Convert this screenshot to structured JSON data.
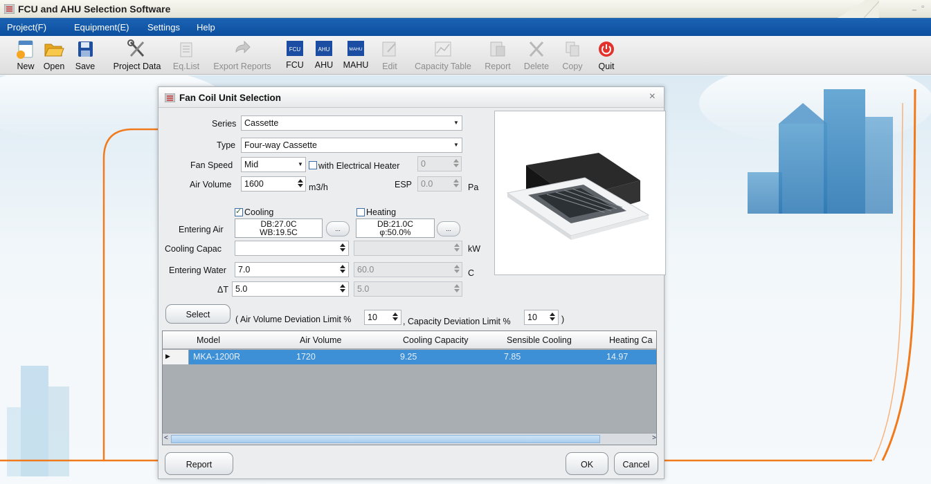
{
  "window": {
    "title": "FCU and AHU Selection Software",
    "controls": "_ ▫"
  },
  "menu": [
    "Project(F)",
    "Equipment(E)",
    "Settings",
    "Help"
  ],
  "toolbar": [
    {
      "label": "New",
      "icon": "new-project-icon",
      "enabled": true
    },
    {
      "label": "Open",
      "icon": "open-folder-icon",
      "enabled": true
    },
    {
      "label": "Save",
      "icon": "save-disk-icon",
      "enabled": true
    },
    {
      "label": "Project Data",
      "icon": "tools-icon",
      "enabled": true
    },
    {
      "label": "Eq.List",
      "icon": "list-icon",
      "enabled": false
    },
    {
      "label": "Export Reports",
      "icon": "export-arrow-icon",
      "enabled": false
    },
    {
      "label": "FCU",
      "icon": "fcu-icon",
      "enabled": true
    },
    {
      "label": "AHU",
      "icon": "ahu-icon",
      "enabled": true
    },
    {
      "label": "MAHU",
      "icon": "mahu-icon",
      "enabled": true
    },
    {
      "label": "Edit",
      "icon": "edit-icon",
      "enabled": false
    },
    {
      "label": "Capacity Table",
      "icon": "chart-icon",
      "enabled": false
    },
    {
      "label": "Report",
      "icon": "report-icon",
      "enabled": false
    },
    {
      "label": "Delete",
      "icon": "delete-x-icon",
      "enabled": false
    },
    {
      "label": "Copy",
      "icon": "copy-icon",
      "enabled": false
    },
    {
      "label": "Quit",
      "icon": "power-icon",
      "enabled": true
    }
  ],
  "toolbar_icon_text": {
    "fcu": "FCU",
    "ahu": "AHU",
    "mahu": "MAHU"
  },
  "dialog": {
    "title": "Fan Coil Unit Selection",
    "close": "×",
    "series_label": "Series",
    "series_value": "Cassette",
    "type_label": "Type",
    "type_value": "Four-way Cassette",
    "fan_speed_label": "Fan Speed",
    "fan_speed_value": "Mid",
    "heater_label": "with Electrical Heater",
    "heater_checked": false,
    "heater_value": "0",
    "air_volume_label": "Air Volume",
    "air_volume_value": "1600",
    "air_volume_unit": "m3/h",
    "esp_label": "ESP",
    "esp_value": "0.0",
    "esp_unit": "Pa",
    "cooling_label": "Cooling",
    "cooling_checked": true,
    "heating_label": "Heating",
    "heating_checked": false,
    "entering_air_label": "Entering Air",
    "cool_air_db": "DB:27.0C",
    "cool_air_wb": "WB:19.5C",
    "heat_air_db": "DB:21.0C",
    "heat_air_phi": "φ:50.0%",
    "dots": "...",
    "capacity_label": "Cooling Capac",
    "capacity_cool_value": "",
    "capacity_heat_value": "",
    "capacity_unit": "kW",
    "entering_water_label": "Entering Water",
    "entering_water_cool": "7.0",
    "entering_water_heat": "60.0",
    "entering_water_unit": "C",
    "dt_label": "ΔT",
    "dt_cool": "5.0",
    "dt_heat": "5.0",
    "select_button": "Select",
    "air_dev_label": "( Air Volume Deviation Limit %",
    "air_dev_value": "10",
    "cap_dev_label": ",  Capacity Deviation Limit %",
    "cap_dev_value": "10",
    "close_paren": ")",
    "grid": {
      "columns": [
        "Model",
        "Air Volume",
        "Cooling Capacity",
        "Sensible Cooling",
        "Heating Ca"
      ],
      "rows": [
        [
          "MKA-1200R",
          "1720",
          "9.25",
          "7.85",
          "14.97"
        ]
      ],
      "row_marker": "▶"
    },
    "report_button": "Report",
    "ok_button": "OK",
    "cancel_button": "Cancel"
  },
  "colors": {
    "menubar": "#0c4f9f",
    "accent_orange": "#f07a1c",
    "selected_row": "#3d8fd6",
    "quit_red": "#e4312b"
  }
}
